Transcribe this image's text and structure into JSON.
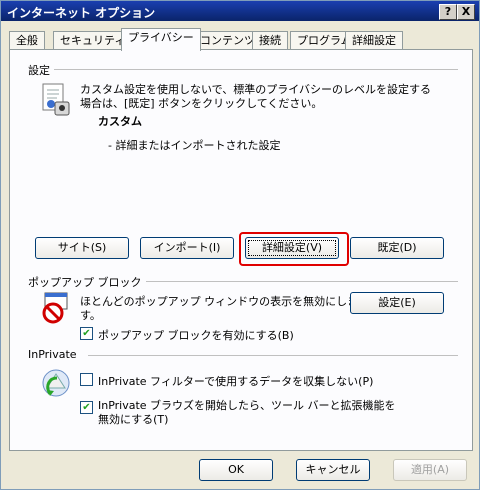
{
  "window": {
    "title": "インターネット オプション",
    "help_label": "?",
    "close_label": "X"
  },
  "tabs": [
    {
      "label": "全般"
    },
    {
      "label": "セキュリティ"
    },
    {
      "label": "プライバシー"
    },
    {
      "label": "コンテンツ"
    },
    {
      "label": "接続"
    },
    {
      "label": "プログラム"
    },
    {
      "label": "詳細設定"
    }
  ],
  "settings": {
    "group_label": "設定",
    "description_line1": "カスタム設定を使用しないで、標準のプライバシーのレベルを設定する",
    "description_line2": "場合は、[既定] ボタンをクリックしてください。",
    "level_title": "カスタム",
    "level_detail": "- 詳細またはインポートされた設定",
    "buttons": {
      "sites": "サイト(S)",
      "import": "インポート(I)",
      "advanced": "詳細設定(V)",
      "default": "既定(D)"
    }
  },
  "popup": {
    "group_label": "ポップアップ ブロック",
    "description_line1": "ほとんどのポップアップ ウィンドウの表示を無効にしま",
    "description_line2": "す。",
    "settings_button": "設定(E)",
    "checkbox_label": "ポップアップ ブロックを有効にする(B)",
    "checkbox_checked": true
  },
  "inprivate": {
    "group_label": "InPrivate",
    "checkbox1_label": "InPrivate フィルターで使用するデータを収集しない(P)",
    "checkbox1_checked": false,
    "checkbox2_label_line1": "InPrivate ブラウズを開始したら、ツール バーと拡張機能を",
    "checkbox2_label_line2": "無効にする(T)",
    "checkbox2_checked": true
  },
  "footer": {
    "ok": "OK",
    "cancel": "キャンセル",
    "apply": "適用(A)"
  }
}
